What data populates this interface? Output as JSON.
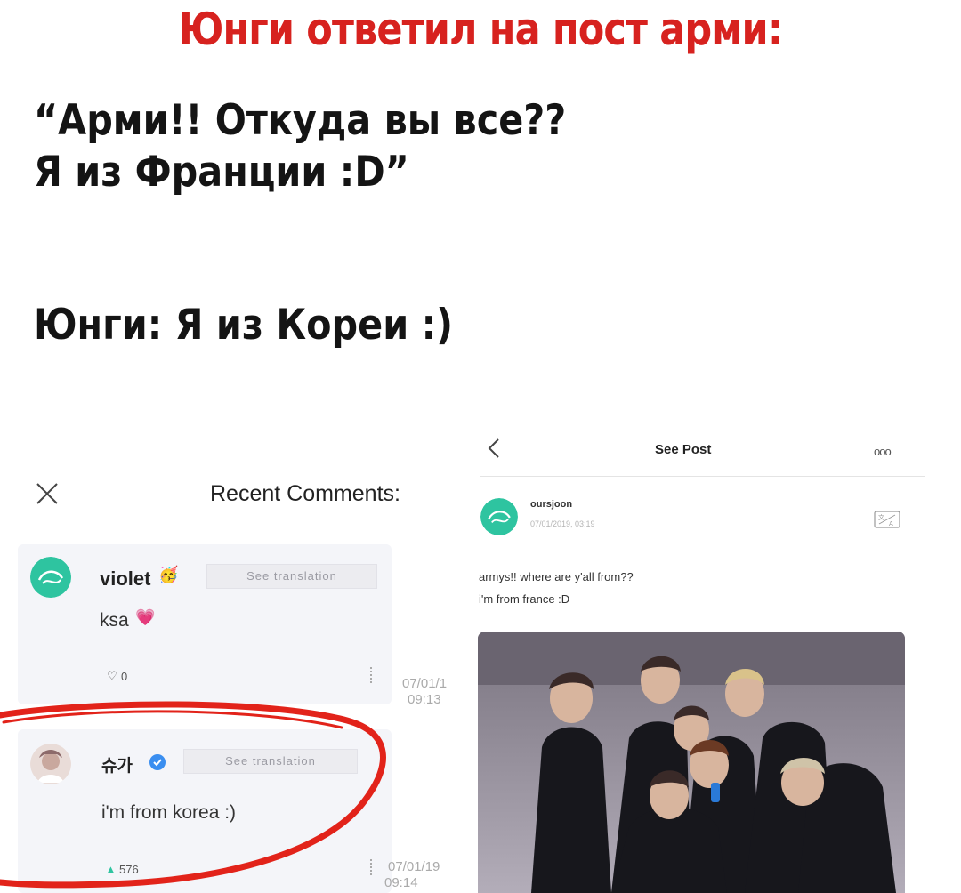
{
  "headline": "Юнги ответил на пост арми:",
  "quote": {
    "line1": "“Арми!! Откуда вы все??",
    "line2": "Я из Франции :D”",
    "line3": "Юнги: Я из Кореи :)"
  },
  "comments_screen": {
    "title": "Recent Comments:",
    "comments": [
      {
        "user": "violet",
        "user_emoji": "🥳",
        "translate_label": "See translation",
        "text": "ksa",
        "text_emoji": "💗",
        "likes": "0",
        "date": "07/01/1",
        "time": "09:13"
      },
      {
        "user": "슈가",
        "translate_label": "See translation",
        "text": "i'm from korea :)",
        "likes": "576",
        "date": "07/01/19",
        "time": "09:14"
      }
    ]
  },
  "post_screen": {
    "title": "See Post",
    "more": "ooo",
    "username": "oursjoon",
    "timestamp": "07/01/2019, 03:19",
    "text_line1": "armys!! where are y'all from??",
    "text_line2": "i'm from france :D"
  },
  "colors": {
    "headline_red": "#d7221f",
    "avatar_green": "#2ec4a0",
    "verified_blue": "#3a8ef0",
    "circle_red": "#e2231a"
  }
}
